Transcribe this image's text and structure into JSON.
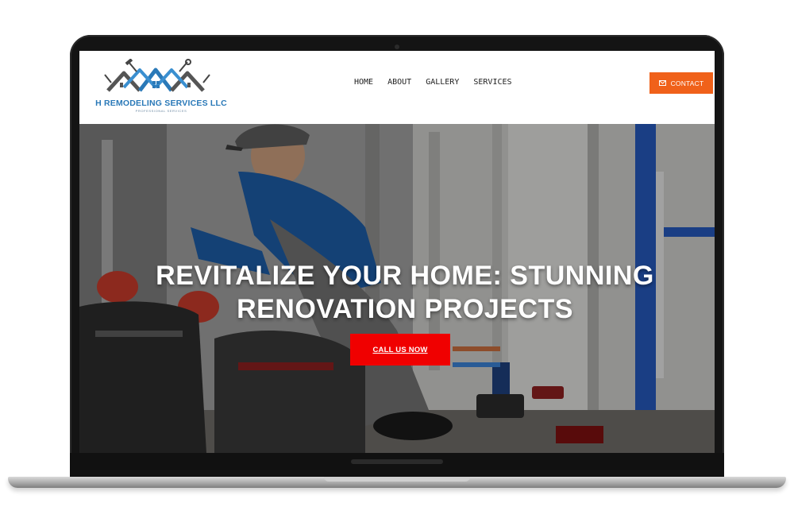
{
  "brand": {
    "name": "H REMODELING SERVICES LLC",
    "tagline": "PROFESSIONAL SERVICES"
  },
  "nav": {
    "items": [
      "HOME",
      "ABOUT",
      "GALLERY",
      "SERVICES"
    ]
  },
  "header": {
    "contact_label": "CONTACT"
  },
  "hero": {
    "title_line1": "REVITALIZE YOUR HOME: STUNNING",
    "title_line2": "RENOVATION PROJECTS",
    "cta_label": "CALL US NOW"
  },
  "colors": {
    "contact_button": "#f0611a",
    "cta_button": "#f00000",
    "logo_blue": "#2a79b8"
  },
  "icons": [
    "envelope-icon",
    "house-roof-logo-icon",
    "hammer-icon",
    "wrench-icon"
  ]
}
